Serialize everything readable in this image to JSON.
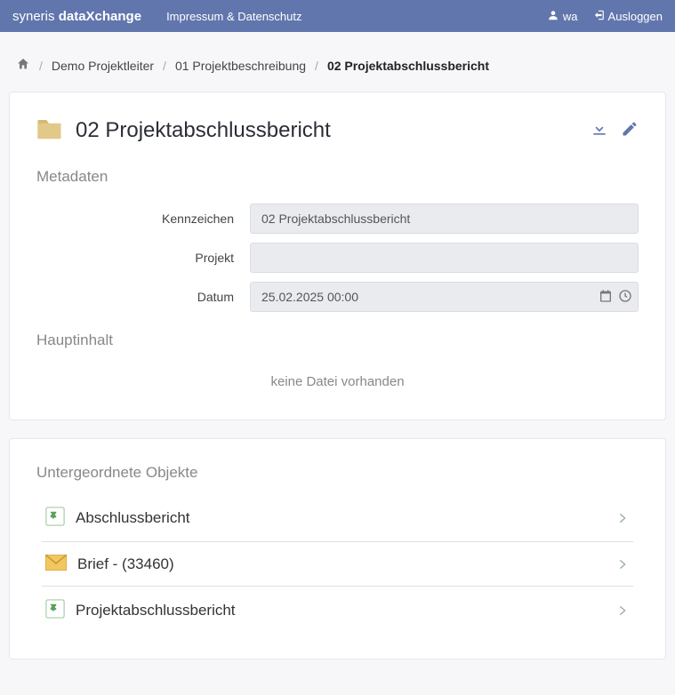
{
  "topbar": {
    "brand_prefix": "syneris ",
    "brand_bold": "dataXchange",
    "link": "Impressum & Datenschutz",
    "user": "wa",
    "logout": "Ausloggen"
  },
  "breadcrumb": {
    "items": [
      {
        "label": "Demo Projektleiter"
      },
      {
        "label": "01 Projektbeschreibung"
      }
    ],
    "current": "02 Projektabschlussbericht"
  },
  "detail": {
    "title": "02 Projektabschlussbericht",
    "section_metadata": "Metadaten",
    "fields": {
      "kennzeichen_label": "Kennzeichen",
      "kennzeichen_value": "02 Projektabschlussbericht",
      "projekt_label": "Projekt",
      "projekt_value": "",
      "datum_label": "Datum",
      "datum_value": "25.02.2025 00:00"
    },
    "section_main": "Hauptinhalt",
    "no_file": "keine Datei vorhanden"
  },
  "children": {
    "heading": "Untergeordnete Objekte",
    "items": [
      {
        "icon": "piece",
        "label": "Abschlussbericht"
      },
      {
        "icon": "mail",
        "label": "Brief - (33460)"
      },
      {
        "icon": "piece",
        "label": "Projektabschlussbericht"
      }
    ]
  }
}
